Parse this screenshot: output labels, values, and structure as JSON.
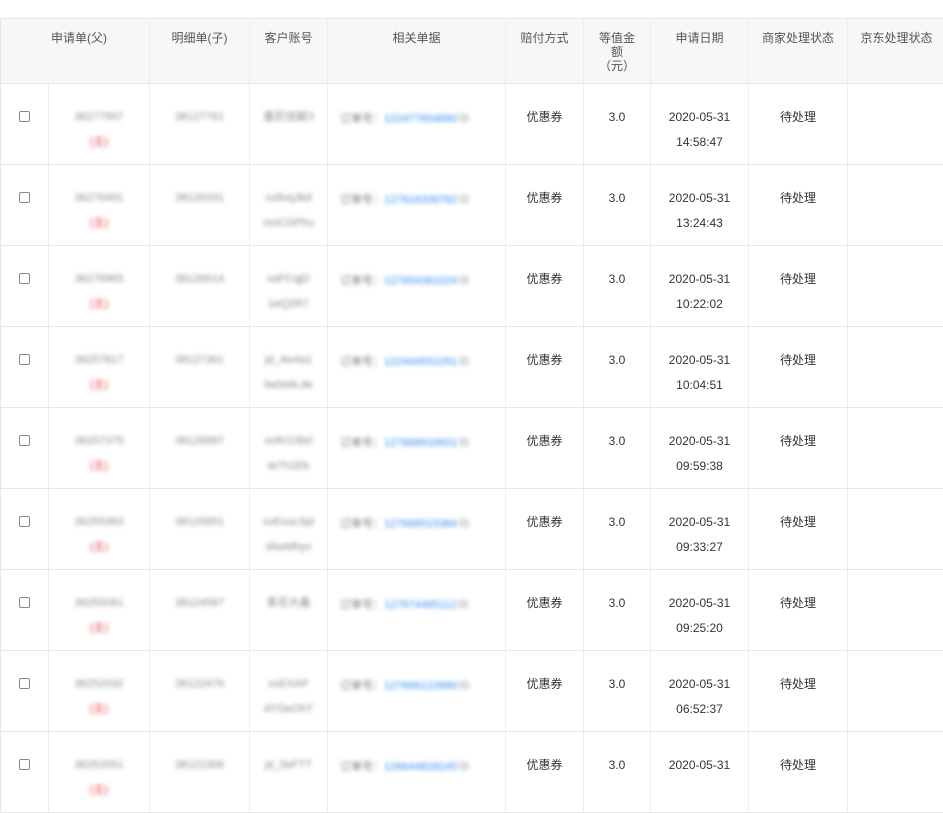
{
  "table": {
    "headers": {
      "parent_order": "申请单(父)",
      "child_order": "明细单(子)",
      "customer_account": "客户账号",
      "related_doc": "相关单据",
      "payment_method": "赔付方式",
      "amount_line1": "等值金",
      "amount_line2": "额",
      "amount_line3": "（元）",
      "apply_date": "申请日期",
      "merchant_status": "商家处理状态",
      "jd_status": "京东处理状态"
    },
    "rows": [
      {
        "parent_id": "36277957",
        "parent_tag": "(主)",
        "child_id": "38127761",
        "account_1": "嘉尼佳献3",
        "account_2": "",
        "doc_prefix": "订单号：",
        "doc_number": "122477654890",
        "payment": "优惠券",
        "amount": "3.0",
        "date": "2020-05-31",
        "time": "14:58:47",
        "merchant_status": "待处理",
        "jd_status": ""
      },
      {
        "parent_id": "36276491",
        "parent_tag": "(主)",
        "child_id": "38126331",
        "account_1": "xx8vqJbd",
        "account_2": "moCGPhu",
        "doc_prefix": "订单号：",
        "doc_number": "127616339782",
        "payment": "优惠券",
        "amount": "3.0",
        "date": "2020-05-31",
        "time": "13:24:43",
        "merchant_status": "待处理",
        "jd_status": ""
      },
      {
        "parent_id": "36276965",
        "parent_tag": "(主)",
        "child_id": "38126614",
        "account_1": "xaFCqjD",
        "account_2": "1eQ2R7",
        "doc_prefix": "订单号：",
        "doc_number": "127654361024",
        "payment": "优惠券",
        "amount": "3.0",
        "date": "2020-05-31",
        "time": "10:22:02",
        "merchant_status": "待处理",
        "jd_status": ""
      },
      {
        "parent_id": "36257817",
        "parent_tag": "(主)",
        "child_id": "38127361",
        "account_1": "jd_4w4a1",
        "account_2": "9a0d4Lde",
        "doc_prefix": "订单号：",
        "doc_number": "122444551051",
        "payment": "优惠券",
        "amount": "3.0",
        "date": "2020-05-31",
        "time": "10:04:51",
        "merchant_status": "待处理",
        "jd_status": ""
      },
      {
        "parent_id": "36257379",
        "parent_tag": "(主)",
        "child_id": "38126897",
        "account_1": "xxfKO3b0",
        "account_2": "te7h1Eb",
        "doc_prefix": "订单号：",
        "doc_number": "127668916601",
        "payment": "优惠券",
        "amount": "3.0",
        "date": "2020-05-31",
        "time": "09:59:38",
        "merchant_status": "待处理",
        "jd_status": ""
      },
      {
        "parent_id": "36255383",
        "parent_tag": "(主)",
        "child_id": "38125951",
        "account_1": "xxEvuL5jd",
        "account_2": "dAeMhyv",
        "doc_prefix": "订单号：",
        "doc_number": "127666515384",
        "payment": "优惠券",
        "amount": "3.0",
        "date": "2020-05-31",
        "time": "09:33:27",
        "merchant_status": "待处理",
        "jd_status": ""
      },
      {
        "parent_id": "36255061",
        "parent_tag": "(主)",
        "child_id": "38124587",
        "account_1": "青花大鑫",
        "account_2": "",
        "doc_prefix": "订单号：",
        "doc_number": "127674485112",
        "payment": "优惠券",
        "amount": "3.0",
        "date": "2020-05-31",
        "time": "09:25:20",
        "merchant_status": "待处理",
        "jd_status": ""
      },
      {
        "parent_id": "36252032",
        "parent_tag": "(主)",
        "child_id": "38122479",
        "account_1": "xxEXAP",
        "account_2": "ATGeOhT",
        "doc_prefix": "订单号：",
        "doc_number": "127666122680",
        "payment": "优惠券",
        "amount": "3.0",
        "date": "2020-05-31",
        "time": "06:52:37",
        "merchant_status": "待处理",
        "jd_status": ""
      },
      {
        "parent_id": "36252051",
        "parent_tag": "(主)",
        "child_id": "38121306",
        "account_1": "jd_5eFTT",
        "account_2": "",
        "doc_prefix": "订单号：",
        "doc_number": "126644828245",
        "payment": "优惠券",
        "amount": "3.0",
        "date": "2020-05-31",
        "time": "",
        "merchant_status": "待处理",
        "jd_status": ""
      }
    ]
  }
}
